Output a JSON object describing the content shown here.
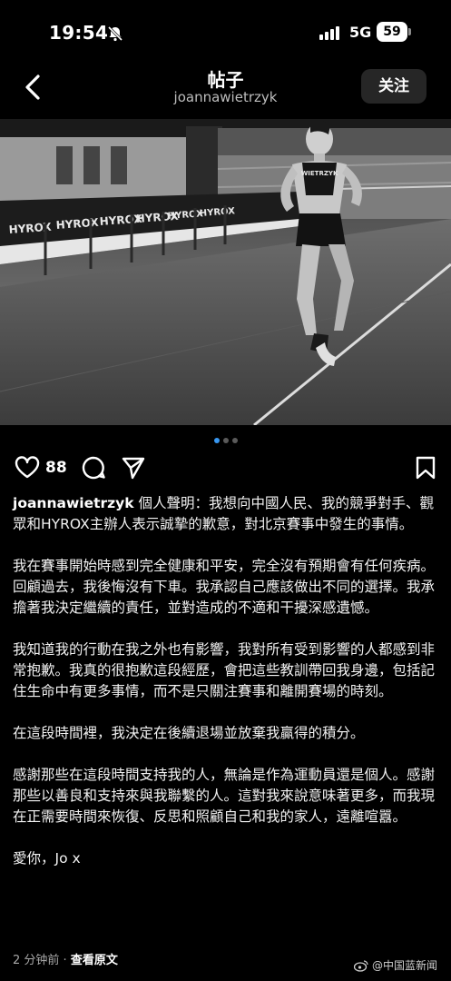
{
  "status_bar": {
    "time": "19:54",
    "network": "5G",
    "battery": "59"
  },
  "nav": {
    "title": "帖子",
    "subtitle": "joannawietrzyk",
    "follow_label": "关注"
  },
  "photo": {
    "banner_text": [
      "HYROX",
      "HYROX",
      "HYROX",
      "HYROX",
      "HYROX",
      "HYROX"
    ],
    "bib_name": "WIETRZYK"
  },
  "carousel": {
    "total": 3,
    "active": 1
  },
  "actions": {
    "like_count": "88"
  },
  "caption": {
    "username": "joannawietrzyk",
    "intro": "個人聲明：我想向中國人民、我的競爭對手、觀眾和HYROX主辦人表示誠摯的歉意，對北京賽事中發生的事情。",
    "paragraphs": [
      "我在賽事開始時感到完全健康和平安，完全沒有預期會有任何疾病。回顧過去，我後悔沒有下車。我承認自己應該做出不同的選擇。我承擔著我決定繼續的責任，並對造成的不適和干擾深感遺憾。",
      "我知道我的行動在我之外也有影響，我對所有受到影響的人都感到非常抱歉。我真的很抱歉這段經歷，會把這些教訓帶回我身邊，包括記住生命中有更多事情，而不是只關注賽事和離開賽場的時刻。",
      "在這段時間裡，我決定在後續退場並放棄我贏得的積分。",
      "感謝那些在這段時間支持我的人，無論是作為運動員還是個人。感謝那些以善良和支持來與我聯繫的人。這對我來說意味著更多，而我現在正需要時間來恢復、反思和照顧自己和我的家人，遠離喧囂。"
    ],
    "sign_off": "愛你，Jo x"
  },
  "meta": {
    "time_ago": "2 分钟前",
    "separator": "·",
    "see_original": "查看原文"
  },
  "watermark": {
    "text": "@中国蓝新闻"
  },
  "colors": {
    "background": "#000000",
    "accent": "#3897f0",
    "follow_bg": "#262626"
  }
}
